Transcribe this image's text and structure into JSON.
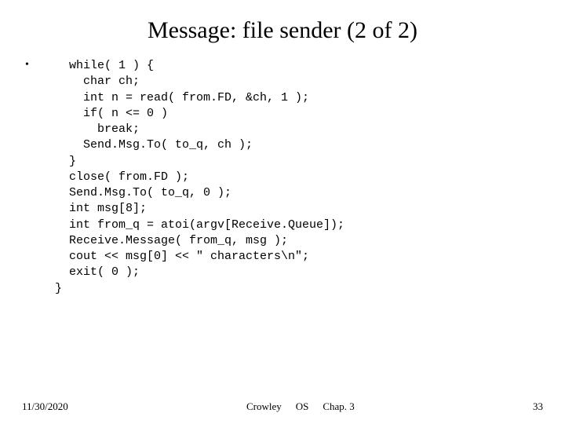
{
  "title": "Message: file sender (2 of 2)",
  "bullet_glyph": "•",
  "code": "  while( 1 ) {\n    char ch;\n    int n = read( from.FD, &ch, 1 );\n    if( n <= 0 )\n      break;\n    Send.Msg.To( to_q, ch );\n  }\n  close( from.FD );\n  Send.Msg.To( to_q, 0 );\n  int msg[8];\n  int from_q = atoi(argv[Receive.Queue]);\n  Receive.Message( from_q, msg );\n  cout << msg[0] << \" characters\\n\";\n  exit( 0 );\n}",
  "footer": {
    "date": "11/30/2020",
    "author": "Crowley",
    "course": "OS",
    "chapter": "Chap. 3",
    "page": "33"
  }
}
